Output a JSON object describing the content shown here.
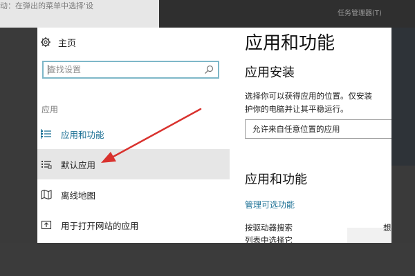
{
  "background": {
    "top_left_text": "动：在弹出的菜单中选择'设",
    "menu_item": "任务管理器(T)"
  },
  "sidebar": {
    "home_label": "主页",
    "search_placeholder": "查找设置",
    "section_label": "应用",
    "items": [
      {
        "label": "应用和功能",
        "icon": "apps-list-icon",
        "state": "active"
      },
      {
        "label": "默认应用",
        "icon": "default-apps-icon",
        "state": "hover"
      },
      {
        "label": "离线地图",
        "icon": "offline-map-icon",
        "state": "normal"
      },
      {
        "label": "用于打开网站的应用",
        "icon": "open-site-icon",
        "state": "normal"
      }
    ]
  },
  "content": {
    "page_title": "应用和功能",
    "install_title": "应用安装",
    "install_desc_line1": "选择你可以获得应用的位置。仅安装",
    "install_desc_line2": "护你的电脑并让其平稳运行。",
    "install_source_selected": "允许来自任意位置的应用",
    "apps_title": "应用和功能",
    "manage_optional_link": "管理可选功能",
    "driver_text_line1": "按驱动器搜索",
    "driver_text_suffix": "想",
    "driver_text_line2": "列表中选择它"
  },
  "colors": {
    "accent": "#1a6f94",
    "search_border": "#7eb7c8",
    "hover_bg": "#e6e6e6",
    "arrow": "#d9322e"
  }
}
